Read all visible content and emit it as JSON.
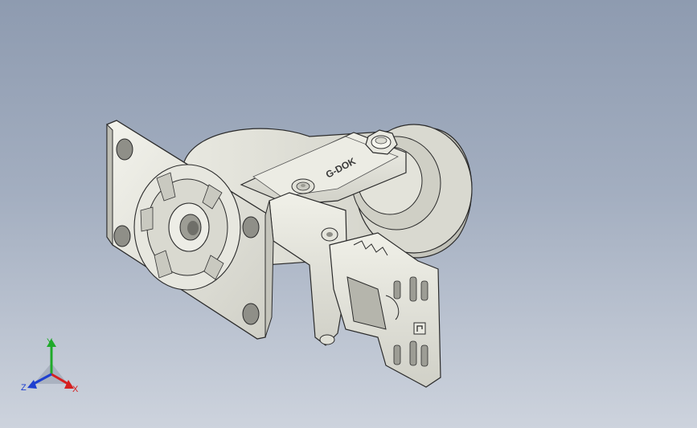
{
  "viewport": {
    "background_top": "#8e9bb0",
    "background_bottom": "#cdd3dd"
  },
  "model": {
    "description_icon": "caster-wheel-with-brake-icon",
    "brand_marking": "G-DOK",
    "part_color": "#e4e4dc",
    "edge_color": "#2b2b2b"
  },
  "triad": {
    "x_label": "X",
    "y_label": "Y",
    "z_label": "Z",
    "x_color": "#d62020",
    "y_color": "#1faa2a",
    "z_color": "#1e3fd0"
  }
}
